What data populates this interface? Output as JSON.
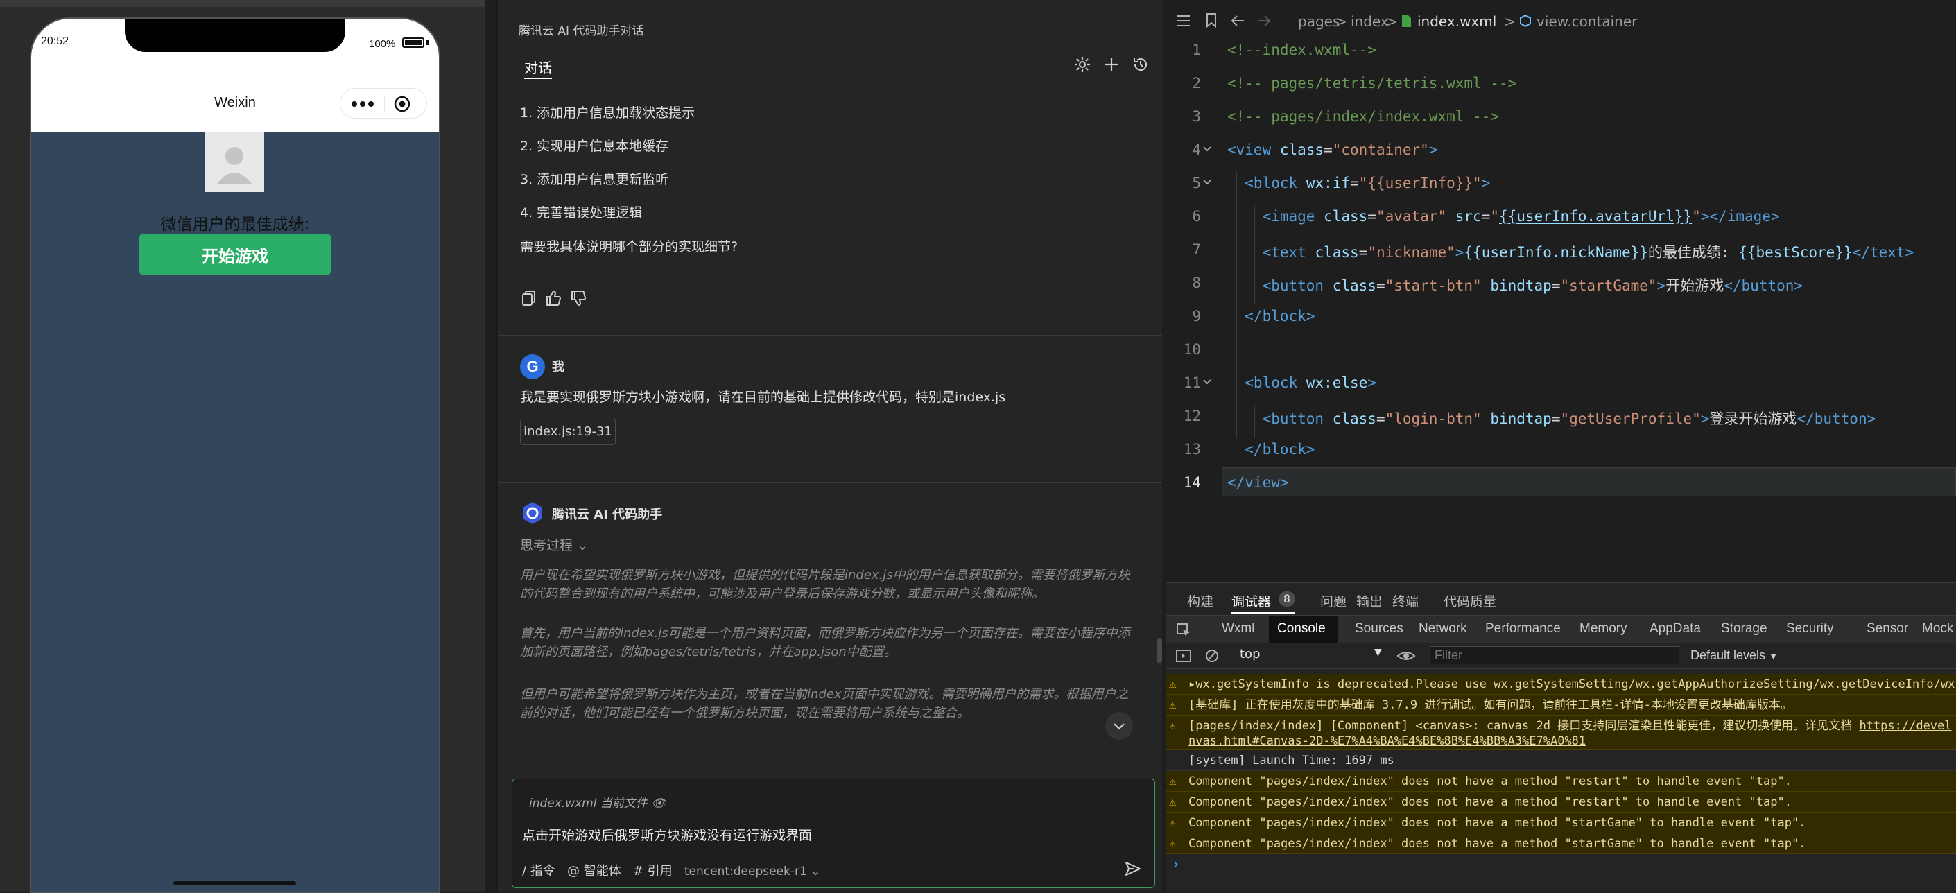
{
  "simulator": {
    "time": "20:52",
    "battery": "100%",
    "nav_title": "Weixin",
    "best_score_text": "微信用户的最佳成绩:",
    "start_button": "开始游戏"
  },
  "chat": {
    "header_title": "腾讯云 AI 代码助手对话",
    "tab": "对话",
    "steps": [
      "1. 添加用户信息加载状态提示",
      "2. 实现用户信息本地缓存",
      "3. 添加用户信息更新监听",
      "4. 完善错误处理逻辑"
    ],
    "question": "需要我具体说明哪个部分的实现细节?",
    "user_name": "我",
    "user_avatar_letter": "G",
    "user_message": "我是要实现俄罗斯方块小游戏啊，请在目前的基础上提供修改代码，特别是index.js",
    "file_chip": "index.js:19-31",
    "assistant_name": "腾讯云 AI 代码助手",
    "thinking_label": "思考过程",
    "thinking": [
      "用户现在希望实现俄罗斯方块小游戏，但提供的代码片段是index.js中的用户信息获取部分。需要将俄罗斯方块的代码整合到现有的用户系统中，可能涉及用户登录后保存游戏分数，或显示用户头像和昵称。",
      "首先，用户当前的index.js可能是一个用户资料页面，而俄罗斯方块应作为另一个页面存在。需要在小程序中添加新的页面路径，例如pages/tetris/tetris，并在app.json中配置。",
      "但用户可能希望将俄罗斯方块作为主页，或者在当前index页面中实现游戏。需要明确用户的需求。根据用户之前的对话，他们可能已经有一个俄罗斯方块页面，现在需要将用户系统与之整合。"
    ],
    "input": {
      "context_file": "index.wxml",
      "context_label": "当前文件",
      "text": "点击开始游戏后俄罗斯方块游戏没有运行游戏界面",
      "tool_command": "/ 指令",
      "tool_agent": "@ 智能体",
      "tool_cite": "# 引用",
      "model": "tencent:deepseek-r1"
    }
  },
  "editor": {
    "breadcrumb": [
      "pages",
      "index",
      "index.wxml",
      "view.container"
    ],
    "lines": [
      {
        "no": "1",
        "tokens": [
          {
            "t": "<!--index.wxml-->",
            "c": "comment"
          }
        ]
      },
      {
        "no": "2",
        "tokens": [
          {
            "t": "<!-- pages/tetris/tetris.wxml -->",
            "c": "comment"
          }
        ]
      },
      {
        "no": "3",
        "tokens": [
          {
            "t": "<!-- pages/index/index.wxml -->",
            "c": "comment"
          }
        ]
      },
      {
        "no": "4",
        "tokens": [
          {
            "t": "<view ",
            "c": "tag"
          },
          {
            "t": "class",
            "c": "attr"
          },
          {
            "t": "=",
            "c": "text"
          },
          {
            "t": "\"container\"",
            "c": "str"
          },
          {
            "t": ">",
            "c": "tag"
          }
        ]
      },
      {
        "no": "5",
        "tokens": [
          {
            "t": "  <block ",
            "c": "tag"
          },
          {
            "t": "wx:if",
            "c": "attr"
          },
          {
            "t": "=",
            "c": "text"
          },
          {
            "t": "\"{{userInfo}}\"",
            "c": "str"
          },
          {
            "t": ">",
            "c": "tag"
          }
        ]
      },
      {
        "no": "6",
        "tokens": [
          {
            "t": "    <image ",
            "c": "tag"
          },
          {
            "t": "class",
            "c": "attr"
          },
          {
            "t": "=",
            "c": "text"
          },
          {
            "t": "\"avatar\"",
            "c": "str"
          },
          {
            "t": " src",
            "c": "attr"
          },
          {
            "t": "=",
            "c": "text"
          },
          {
            "t": "\"",
            "c": "str"
          },
          {
            "t": "{{userInfo.avatarUrl}}",
            "c": "mustache"
          },
          {
            "t": "\"",
            "c": "str"
          },
          {
            "t": "></image>",
            "c": "tag"
          }
        ]
      },
      {
        "no": "7",
        "tokens": [
          {
            "t": "    <text ",
            "c": "tag"
          },
          {
            "t": "class",
            "c": "attr"
          },
          {
            "t": "=",
            "c": "text"
          },
          {
            "t": "\"nickname\"",
            "c": "str"
          },
          {
            "t": ">",
            "c": "tag"
          },
          {
            "t": "{{userInfo.nickName}}",
            "c": "attr"
          },
          {
            "t": "的最佳成绩: ",
            "c": "text"
          },
          {
            "t": "{{bestScore}}",
            "c": "attr"
          },
          {
            "t": "</text>",
            "c": "tag"
          }
        ]
      },
      {
        "no": "8",
        "tokens": [
          {
            "t": "    <button ",
            "c": "tag"
          },
          {
            "t": "class",
            "c": "attr"
          },
          {
            "t": "=",
            "c": "text"
          },
          {
            "t": "\"start-btn\"",
            "c": "str"
          },
          {
            "t": " bindtap",
            "c": "attr"
          },
          {
            "t": "=",
            "c": "text"
          },
          {
            "t": "\"startGame\"",
            "c": "str"
          },
          {
            "t": ">",
            "c": "tag"
          },
          {
            "t": "开始游戏",
            "c": "text"
          },
          {
            "t": "</button>",
            "c": "tag"
          }
        ]
      },
      {
        "no": "9",
        "tokens": [
          {
            "t": "  </block>",
            "c": "tag"
          }
        ]
      },
      {
        "no": "10",
        "tokens": []
      },
      {
        "no": "11",
        "tokens": [
          {
            "t": "  <block ",
            "c": "tag"
          },
          {
            "t": "wx:else",
            "c": "attr"
          },
          {
            "t": ">",
            "c": "tag"
          }
        ]
      },
      {
        "no": "12",
        "tokens": [
          {
            "t": "    <button ",
            "c": "tag"
          },
          {
            "t": "class",
            "c": "attr"
          },
          {
            "t": "=",
            "c": "text"
          },
          {
            "t": "\"login-btn\"",
            "c": "str"
          },
          {
            "t": " bindtap",
            "c": "attr"
          },
          {
            "t": "=",
            "c": "text"
          },
          {
            "t": "\"getUserProfile\"",
            "c": "str"
          },
          {
            "t": ">",
            "c": "tag"
          },
          {
            "t": "登录开始游戏",
            "c": "text"
          },
          {
            "t": "</button>",
            "c": "tag"
          }
        ]
      },
      {
        "no": "13",
        "tokens": [
          {
            "t": "  </block>",
            "c": "tag"
          }
        ]
      },
      {
        "no": "14",
        "tokens": [
          {
            "t": "</view>",
            "c": "tag"
          }
        ]
      }
    ]
  },
  "console": {
    "panel_tabs": [
      "构建",
      "调试器",
      "问题",
      "输出",
      "终端",
      "代码质量"
    ],
    "debugger_badge": "8",
    "dev_tabs": [
      "Wxml",
      "Console",
      "Sources",
      "Network",
      "Performance",
      "Memory",
      "AppData",
      "Storage",
      "Security",
      "Sensor",
      "Mock"
    ],
    "context": "top",
    "filter_placeholder": "Filter",
    "levels": "Default levels",
    "logs": [
      {
        "level": "warn",
        "text": "▸wx.getSystemInfo is deprecated.Please use wx.getSystemSetting/wx.getAppAuthorizeSetting/wx.getDeviceInfo/wx.ge"
      },
      {
        "level": "warn",
        "text": "[基础库] 正在使用灰度中的基础库 3.7.9 进行调试。如有问题，请前往工具栏-详情-本地设置更改基础库版本。"
      },
      {
        "level": "warn",
        "text": "[pages/index/index] [Component] <canvas>: canvas 2d 接口支持同层渲染且性能更佳，建议切换使用。详见文档 ",
        "link": "https://devel",
        "cont": "nvas.html#Canvas-2D-%E7%A4%BA%E4%BE%8B%E4%BB%A3%E7%A0%81"
      },
      {
        "level": "info",
        "text": "[system] Launch Time: 1697 ms"
      },
      {
        "level": "warn",
        "text": "Component \"pages/index/index\" does not have a method \"restart\" to handle event \"tap\"."
      },
      {
        "level": "warn",
        "text": "Component \"pages/index/index\" does not have a method \"restart\" to handle event \"tap\"."
      },
      {
        "level": "warn",
        "text": "Component \"pages/index/index\" does not have a method \"startGame\" to handle event \"tap\"."
      },
      {
        "level": "warn",
        "text": "Component \"pages/index/index\" does not have a method \"startGame\" to handle event \"tap\"."
      }
    ],
    "prompt": "›"
  }
}
